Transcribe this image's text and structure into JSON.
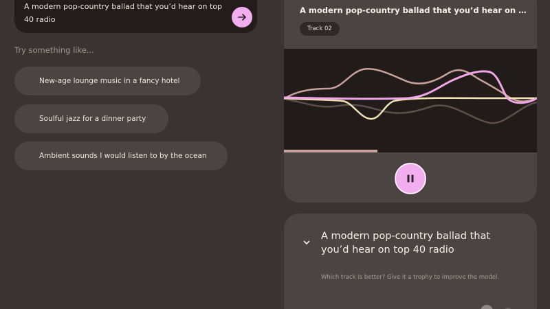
{
  "prompt": {
    "text": "A modern pop-country ballad that you’d hear on top 40 radio",
    "send_icon": "arrow-right-icon"
  },
  "suggestions": {
    "label": "Try something like...",
    "items": [
      "New-age lounge music in a fancy hotel",
      "Soulful jazz for a dinner party",
      "Ambient sounds I would listen to by the ocean"
    ]
  },
  "track": {
    "title": "A modern pop-country ballad that you’d hear on top 40 radio",
    "badge": "Track 02",
    "progress": 0.37,
    "control_icon": "pause-icon"
  },
  "compare": {
    "title": "A modern pop-country ballad that you’d hear on top 40 radio",
    "hint": "Which track is better? Give it a trophy to improve the model.",
    "toggle_icon": "chevron-down-icon"
  },
  "colors": {
    "background": "#3a3331",
    "card": "#4b4442",
    "accent": "#f3aef0",
    "wave_pink": "#f0a6e6",
    "wave_cream": "#efe2b3",
    "wave_taupe": "#c8a39a"
  }
}
